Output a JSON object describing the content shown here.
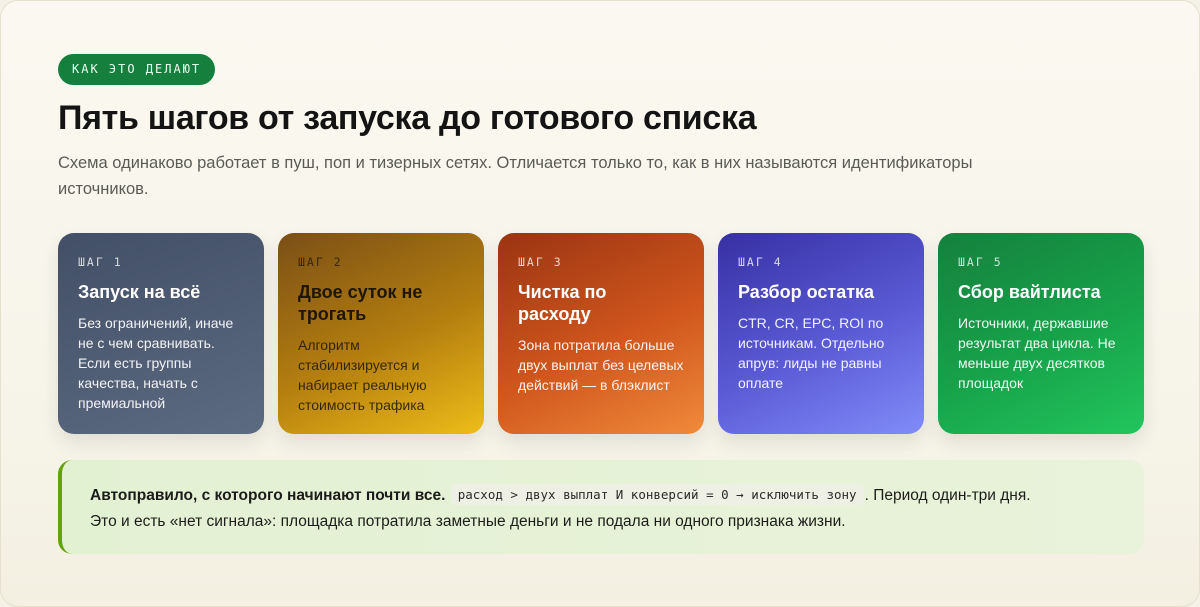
{
  "header": {
    "eyebrow": "КАК ЭТО ДЕЛАЮТ",
    "title": "Пять шагов от запуска до готового списка",
    "subtitle": "Схема одинаково работает в пуш, поп и тизерных сетях. Отличается только то, как в них называются идентификаторы источников."
  },
  "steps": [
    {
      "num": "ШАГ 1",
      "name": "Запуск на всё",
      "text": "Без ограничений, иначе не с чем сравнивать. Если есть группы качества, начать с премиальной"
    },
    {
      "num": "ШАГ 2",
      "name": "Двое суток не трогать",
      "text": "Алгоритм стабилизируется и набирает реальную стоимость трафика"
    },
    {
      "num": "ШАГ 3",
      "name": "Чистка по расходу",
      "text": "Зона потратила больше двух выплат без целевых действий — в блэклист"
    },
    {
      "num": "ШАГ 4",
      "name": "Разбор остатка",
      "text": "CTR, CR, EPC, ROI по источникам. Отдельно апрув: лиды не равны оплате"
    },
    {
      "num": "ШАГ 5",
      "name": "Сбор вайтлиста",
      "text": "Источники, державшие результат два цикла. Не меньше двух десятков площадок"
    }
  ],
  "callout": {
    "lead": "Автоправило, с которого начинают почти все.",
    "code": "расход > двух выплат И конверсий = 0 → исключить зону",
    "after": ". Период один-три дня.",
    "line2": "Это и есть «нет сигнала»: площадка потратила заметные деньги и не подала ни одного признака жизни."
  },
  "colors": {
    "eyebrow_bg": "#15803d",
    "step_1": "#4b5870",
    "step_2": "#c99312",
    "step_3": "#d9632a",
    "step_4": "#5b5bd6",
    "step_5": "#17a34a",
    "callout_accent": "#65a30d"
  }
}
